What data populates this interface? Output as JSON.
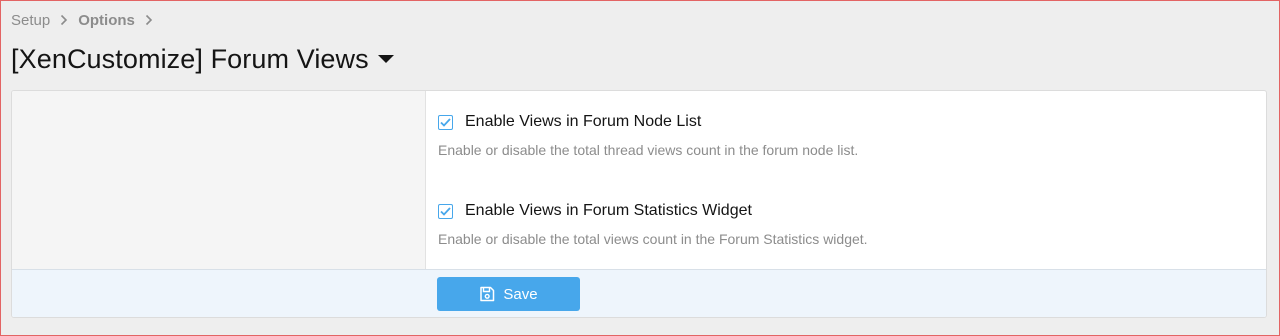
{
  "breadcrumb": {
    "items": [
      {
        "label": "Setup"
      },
      {
        "label": "Options"
      }
    ]
  },
  "page": {
    "title": "[XenCustomize] Forum Views"
  },
  "options": [
    {
      "label": "Enable Views in Forum Node List",
      "hint": "Enable or disable the total thread views count in the forum node list.",
      "checked": true
    },
    {
      "label": "Enable Views in Forum Statistics Widget",
      "hint": "Enable or disable the total views count in the Forum Statistics widget.",
      "checked": true
    }
  ],
  "footer": {
    "save_label": "Save"
  },
  "icons": {
    "breadcrumb_separator": "chevron-right-icon",
    "title_menu": "caret-down-icon",
    "checkbox": "checkmark-icon",
    "save": "floppy-disk-icon"
  },
  "colors": {
    "accent": "#47a7eb",
    "page_background": "#eeeeee",
    "footer_background": "#eef5fc",
    "muted_text": "#8c8c8c"
  }
}
